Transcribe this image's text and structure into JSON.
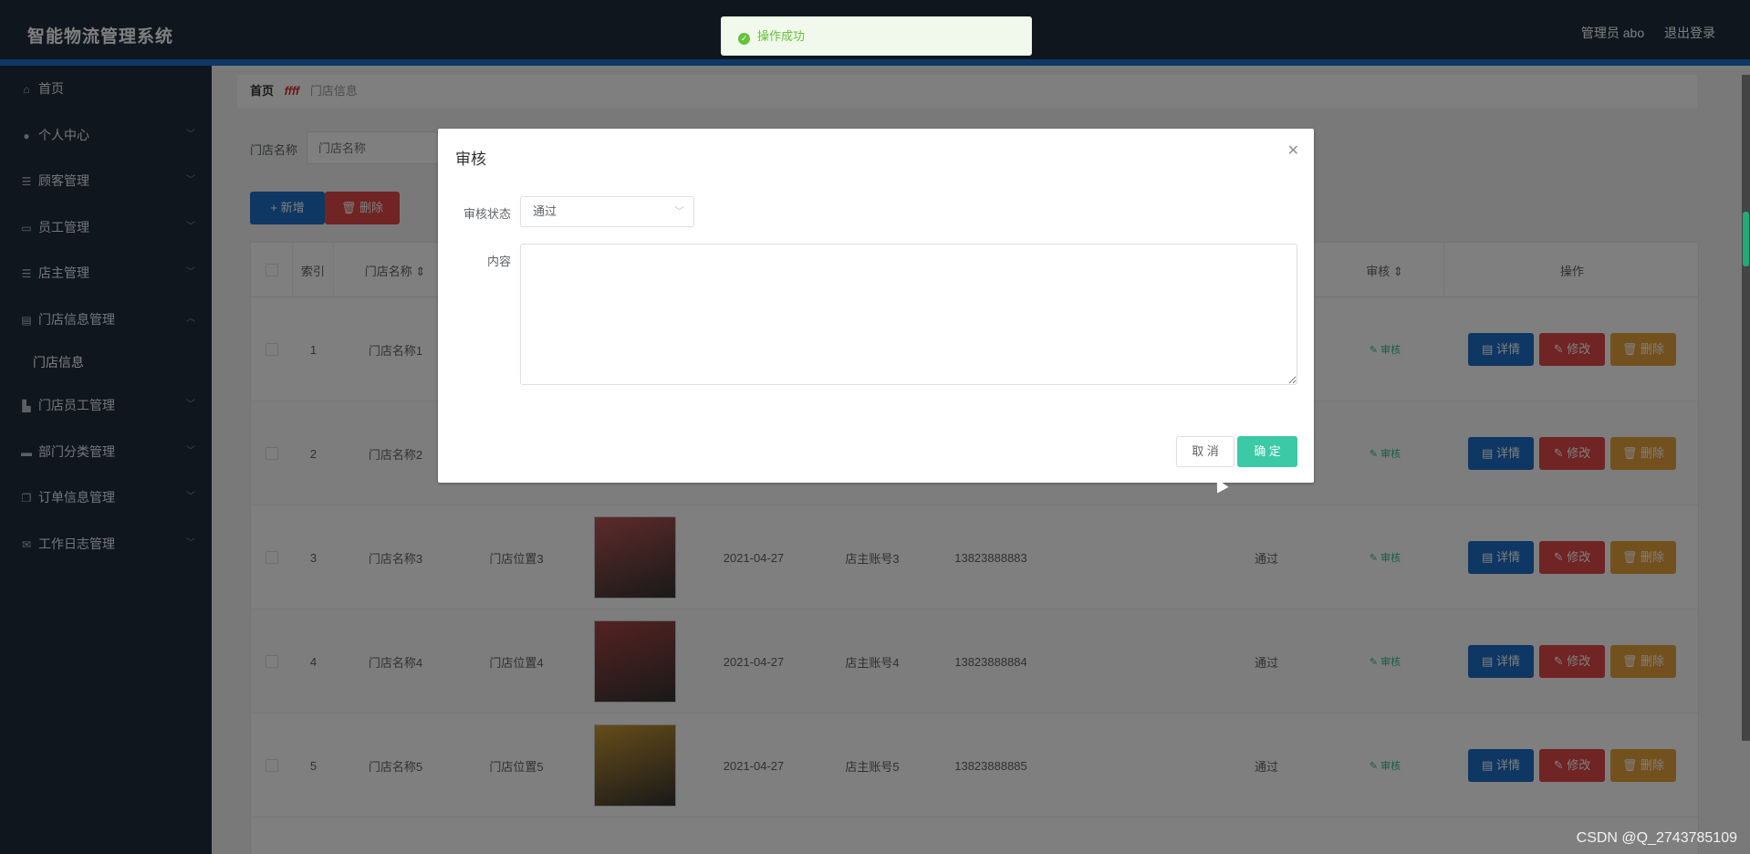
{
  "header": {
    "title": "智能物流管理系统",
    "user_label": "管理员 abo",
    "logout": "退出登录"
  },
  "toast": {
    "message": "操作成功"
  },
  "sidebar": {
    "items": [
      {
        "label": "首页",
        "icon": "home-icon",
        "has_children": false
      },
      {
        "label": "个人中心",
        "icon": "user-icon",
        "has_children": true
      },
      {
        "label": "顾客管理",
        "icon": "list-icon",
        "has_children": true
      },
      {
        "label": "员工管理",
        "icon": "card-icon",
        "has_children": true
      },
      {
        "label": "店主管理",
        "icon": "list-icon",
        "has_children": true
      },
      {
        "label": "门店信息管理",
        "icon": "shop-icon",
        "has_children": true
      },
      {
        "label": "门店员工管理",
        "icon": "chart-icon",
        "has_children": true
      },
      {
        "label": "部门分类管理",
        "icon": "ticket-icon",
        "has_children": true
      },
      {
        "label": "订单信息管理",
        "icon": "copy-icon",
        "has_children": true
      },
      {
        "label": "工作日志管理",
        "icon": "mail-icon",
        "has_children": true
      }
    ],
    "sub_item": "门店信息"
  },
  "breadcrumb": {
    "home": "首页",
    "separator": "ffff",
    "current": "门店信息"
  },
  "search": {
    "label": "门店名称",
    "placeholder": "门店名称"
  },
  "toolbar": {
    "add": "+ 新增",
    "delete": "删除"
  },
  "table": {
    "headers": {
      "index": "索引",
      "name": "门店名称 ⇕",
      "audit": "审核 ⇕",
      "ops": "操作"
    },
    "rows": [
      {
        "idx": "1",
        "name": "门店名称1",
        "loc": "",
        "date": "",
        "owner": "",
        "phone": "",
        "status": "",
        "audit": "✎ 审核"
      },
      {
        "idx": "2",
        "name": "门店名称2",
        "loc": "",
        "date": "",
        "owner": "",
        "phone": "",
        "status": "",
        "audit": "✎ 审核"
      },
      {
        "idx": "3",
        "name": "门店名称3",
        "loc": "门店位置3",
        "date": "2021-04-27",
        "owner": "店主账号3",
        "phone": "13823888883",
        "status": "通过",
        "audit": "✎ 审核"
      },
      {
        "idx": "4",
        "name": "门店名称4",
        "loc": "门店位置4",
        "date": "2021-04-27",
        "owner": "店主账号4",
        "phone": "13823888884",
        "status": "通过",
        "audit": "✎ 审核"
      },
      {
        "idx": "5",
        "name": "门店名称5",
        "loc": "门店位置5",
        "date": "2021-04-27",
        "owner": "店主账号5",
        "phone": "13823888885",
        "status": "通过",
        "audit": "✎ 审核"
      }
    ],
    "op_detail": "详情",
    "op_edit": "修改",
    "op_delete": "删除"
  },
  "dialog": {
    "title": "审核",
    "status_label": "审核状态",
    "status_value": "通过",
    "content_label": "内容",
    "cancel": "取 消",
    "confirm": "确 定"
  },
  "watermark": "CSDN @Q_2743785109"
}
